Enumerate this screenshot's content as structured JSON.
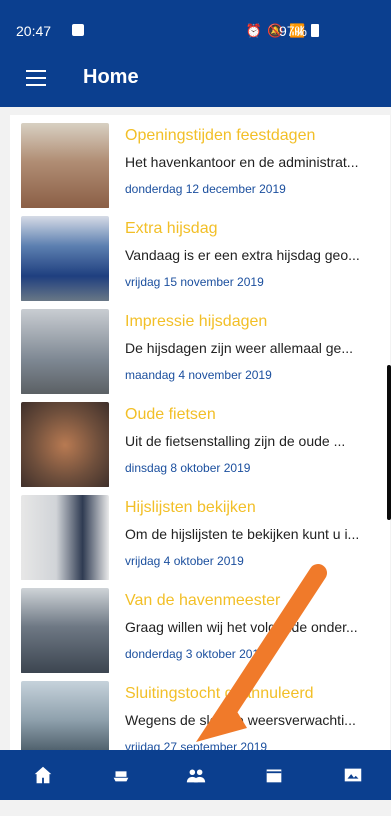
{
  "status_bar": {
    "time": "20:47",
    "icons": [
      "alarm-icon",
      "mute-icon",
      "wifi-icon",
      "signal-icon"
    ],
    "battery_text": "97%"
  },
  "app_bar": {
    "title": "Home",
    "menu_icon": "hamburger-menu-icon"
  },
  "news": [
    {
      "title": "Openingstijden feestdagen",
      "snippet": "Het havenkantoor en de administrat...",
      "date": "donderdag 12 december 2019"
    },
    {
      "title": "Extra hijsdag",
      "snippet": "Vandaag is er een extra hijsdag geo...",
      "date": "vrijdag 15 november 2019"
    },
    {
      "title": "Impressie hijsdagen",
      "snippet": "De hijsdagen zijn weer allemaal ge...",
      "date": "maandag 4 november 2019"
    },
    {
      "title": "Oude fietsen",
      "snippet": "Uit de fietsenstalling zijn de oude ...",
      "date": "dinsdag 8 oktober 2019"
    },
    {
      "title": "Hijslijsten bekijken",
      "snippet": "Om de hijslijsten te bekijken kunt u i...",
      "date": "vrijdag 4 oktober 2019"
    },
    {
      "title": "Van de havenmeester",
      "snippet": "Graag willen wij het volgende onder...",
      "date": "donderdag 3 oktober 2019"
    },
    {
      "title": "Sluitingstocht geannuleerd",
      "snippet": "Wegens de slechte weersverwachti...",
      "date": "vrijdag 27 september 2019"
    }
  ],
  "bottom_nav": {
    "items": [
      {
        "icon": "home-icon"
      },
      {
        "icon": "boat-icon"
      },
      {
        "icon": "people-icon"
      },
      {
        "icon": "calendar-icon"
      },
      {
        "icon": "gallery-icon"
      }
    ]
  },
  "colors": {
    "primary": "#0b3f8f",
    "title": "#f2bf27",
    "date": "#1b4f9e",
    "annotation_arrow": "#f07a2a"
  }
}
